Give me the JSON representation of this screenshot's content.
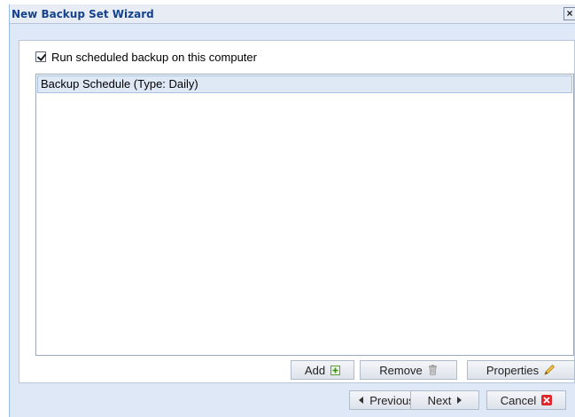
{
  "window": {
    "title": "New Backup Set Wizard",
    "close_glyph": "×"
  },
  "options": {
    "run_scheduled_label": "Run scheduled backup on this computer",
    "run_scheduled_checked": true
  },
  "schedules": {
    "items": [
      {
        "label": "Backup Schedule (Type: Daily)",
        "selected": true
      }
    ]
  },
  "list_actions": {
    "add_label": "Add",
    "add_icon": "add-icon",
    "remove_label": "Remove",
    "remove_icon": "trash-icon",
    "properties_label": "Properties",
    "properties_icon": "edit-icon"
  },
  "navigation": {
    "previous_label": "Previous",
    "next_label": "Next",
    "cancel_label": "Cancel",
    "cancel_icon": "cancel-icon"
  },
  "colors": {
    "title_text": "#15428b",
    "panel_bg": "#dfe8f6",
    "selected_row": "#dfe9f6",
    "cancel_red": "#e0262b"
  }
}
